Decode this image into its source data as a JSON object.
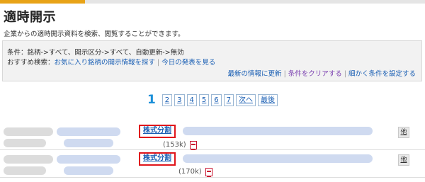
{
  "header": {
    "title": "適時開示",
    "description": "企業からの適時開示資料を検索、閲覧することができます。"
  },
  "conditions": {
    "summary": "条件：銘柄->すべて、開示区分->すべて、自動更新->無効",
    "recommend_label": "おすすめ検索：",
    "recommend_links": [
      "お気に入り銘柄の開示情報を探す",
      "今日の発表を見る"
    ],
    "actions": [
      "最新の情報に更新",
      "条件をクリアする",
      "細かく条件を設定する"
    ]
  },
  "pagination": {
    "current": "1",
    "pages": [
      "2",
      "3",
      "4",
      "5",
      "6",
      "7"
    ],
    "next_label": "次へ",
    "last_label": "最後"
  },
  "rows": [
    {
      "tag": "株式分割",
      "size": "(153k)",
      "other_label": "他"
    },
    {
      "tag": "株式分割",
      "size": "(170k)",
      "other_label": "他"
    }
  ],
  "colors": {
    "accent": "#e8a317",
    "link": "#1a5fb4",
    "highlight_border": "#e0151b",
    "current_page": "#1a8fd8"
  }
}
